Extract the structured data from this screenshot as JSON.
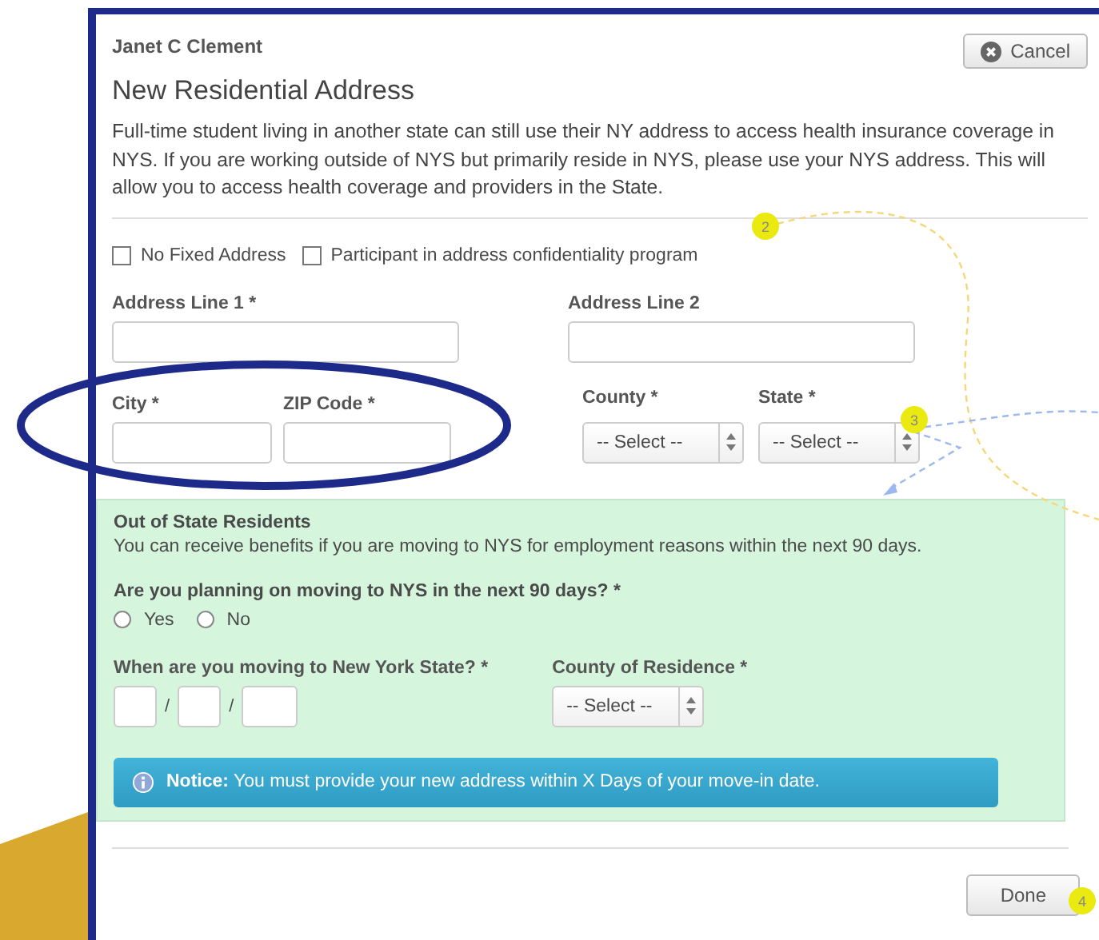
{
  "header": {
    "name": "Janet C Clement",
    "cancel_button": "Cancel"
  },
  "title": "New Residential Address",
  "intro": "Full-time student living in another state can still use their NY address to access health insurance coverage in NYS. If you are working outside of NYS but primarily reside in NYS, please use your NYS address. This will allow you to access health coverage and providers in the State.",
  "options": [
    {
      "label": "No Fixed Address",
      "checked": false
    },
    {
      "label": "Participant in address confidentiality program",
      "checked": false
    }
  ],
  "address_fields": [
    {
      "label": "Address Line 1 *",
      "kind": "text"
    },
    {
      "label": "Address Line 2",
      "kind": "text"
    }
  ],
  "location_fields": [
    {
      "label": "City *",
      "kind": "text"
    },
    {
      "label": "ZIP Code *",
      "kind": "text"
    },
    {
      "label": "County *",
      "kind": "select",
      "value": "-- Select --"
    },
    {
      "label": "State *",
      "kind": "select",
      "value": "-- Select --"
    }
  ],
  "out_of_state": {
    "heading": "Out of State Residents",
    "text": "You can receive benefits if you are moving to NYS for employment reasons within the next 90 days.",
    "question": "Are you planning on moving to NYS in the next 90 days? *",
    "answers": [
      {
        "label": "Yes",
        "selected": false
      },
      {
        "label": "No",
        "selected": false
      }
    ],
    "date_label": "When are you moving to New York State? *",
    "date_separators": [
      "/",
      "/"
    ],
    "county_label": "County of Residence *",
    "county_value": "-- Select --",
    "notice": "**Notice:** You must provide your new address within X Days of your move-in date."
  },
  "done_button": "Done",
  "step_badges": [
    "2",
    "3",
    "4"
  ]
}
